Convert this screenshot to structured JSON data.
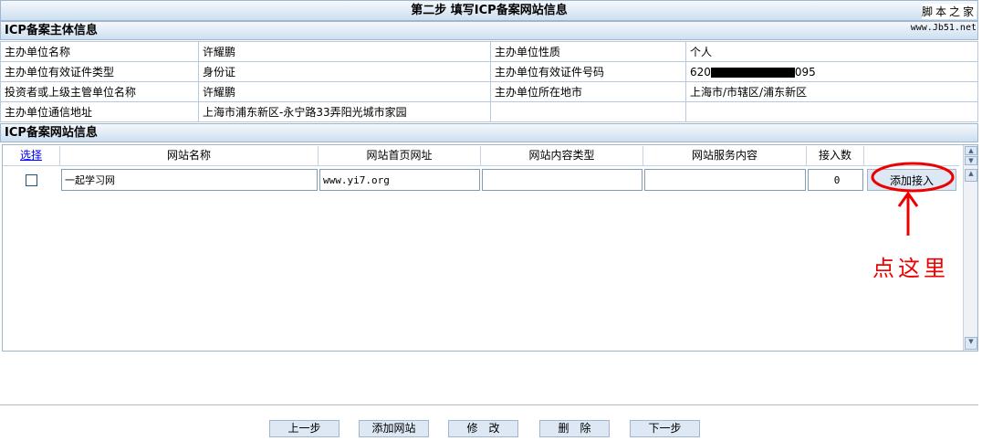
{
  "title": "第二步  填写ICP备案网站信息",
  "watermark": {
    "name": "脚本之家",
    "url": "www.Jb51.net"
  },
  "section1": {
    "title": "ICP备案主体信息",
    "rows": [
      {
        "l1": "主办单位名称",
        "v1": "许耀鹏",
        "l2": "主办单位性质",
        "v2": "个人"
      },
      {
        "l1": "主办单位有效证件类型",
        "v1": "身份证",
        "l2": "主办单位有效证件号码",
        "v2_prefix": "620",
        "v2_suffix": "095"
      },
      {
        "l1": "投资者或上级主管单位名称",
        "v1": "许耀鹏",
        "l2": "主办单位所在地市",
        "v2": "上海市/市辖区/浦东新区"
      },
      {
        "l1": "主办单位通信地址",
        "v1": "上海市浦东新区-永宁路33弄阳光城市家园",
        "l2": "",
        "v2": ""
      }
    ]
  },
  "section2": {
    "title": "ICP备案网站信息",
    "headers": [
      "选择",
      "网站名称",
      "网站首页网址",
      "网站内容类型",
      "网站服务内容",
      "接入数"
    ],
    "row": {
      "name": "一起学习网",
      "url": "www.yi7.org",
      "content_type": "",
      "service": "",
      "count": "0",
      "action": "添加接入"
    }
  },
  "annotation": "点这里",
  "buttons": [
    "上一步",
    "添加网站",
    "修　改",
    "删　除",
    "下一步"
  ]
}
